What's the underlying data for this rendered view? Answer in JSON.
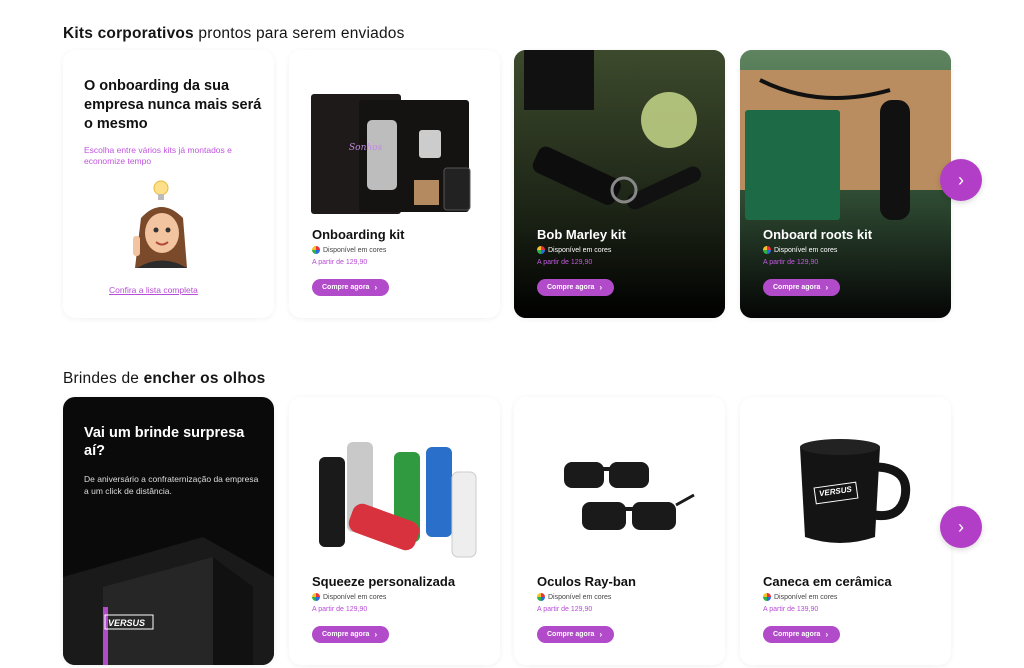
{
  "section1": {
    "title_bold": "Kits corporativos",
    "title_rest": " prontos para serem enviados",
    "promo": {
      "heading": "O onboarding da sua empresa nunca mais será o mesmo",
      "text": "Escolha entre vários kits já montados e economize tempo",
      "link": "Confira a lista completa"
    },
    "products": [
      {
        "name": "Onboarding kit",
        "availability": "Disponível em cores",
        "price": "A partir de 129,90",
        "button": "Compre agora"
      },
      {
        "name": "Bob Marley kit",
        "availability": "Disponível em cores",
        "price": "A partir de 129,90",
        "button": "Compre agora"
      },
      {
        "name": "Onboard roots kit",
        "availability": "Disponível em cores",
        "price": "A partir de 129,90",
        "button": "Compre agora"
      }
    ]
  },
  "section2": {
    "title_rest": "Brindes de ",
    "title_bold": "encher os olhos",
    "promo": {
      "heading": "Vai um brinde surpresa aí?",
      "text": "De aniversário a confraternização da empresa a um click de distância.",
      "box_logo": "VERSUS"
    },
    "products": [
      {
        "name": "Squeeze personalizada",
        "availability": "Disponível em cores",
        "price": "A partir de 129,90",
        "button": "Compre agora"
      },
      {
        "name": "Oculos Ray-ban",
        "availability": "Disponível em cores",
        "price": "A partir de 129,90",
        "button": "Compre agora"
      },
      {
        "name": "Caneca em cerâmica",
        "availability": "Disponível em cores",
        "price": "A partir de 139,90",
        "button": "Compre agora",
        "mug_logo": "VERSUS"
      }
    ]
  },
  "icons": {
    "next": "chevron-right-icon",
    "button_chevron": "chevron-right-icon",
    "color_dot": "color-wheel-icon"
  },
  "colors": {
    "accent": "#b14bc9",
    "price": "#b74cd6"
  }
}
